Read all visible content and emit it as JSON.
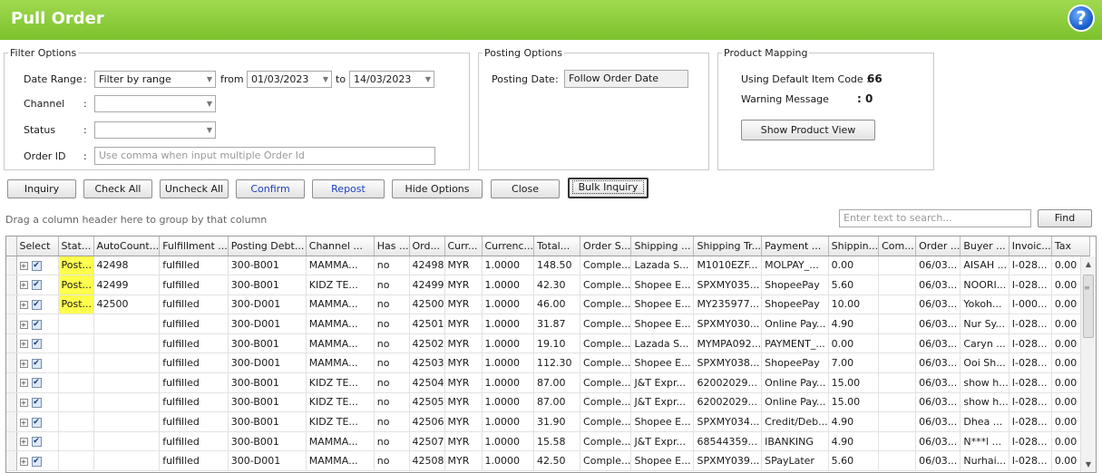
{
  "window": {
    "title": "Pull Order",
    "help_icon": "help-icon"
  },
  "filter_options": {
    "legend": "Filter Options",
    "date_range": {
      "label": "Date Range",
      "value": "Filter by range",
      "from_label": "from",
      "from_value": "01/03/2023",
      "to_label": "to",
      "to_value": "14/03/2023"
    },
    "channel": {
      "label": "Channel",
      "value": ""
    },
    "status": {
      "label": "Status",
      "value": ""
    },
    "order_id": {
      "label": "Order ID",
      "placeholder": "Use comma when input multiple Order Id"
    }
  },
  "posting_options": {
    "legend": "Posting Options",
    "posting_date_label": "Posting Date",
    "posting_date_value": "Follow Order Date"
  },
  "product_mapping": {
    "legend": "Product Mapping",
    "default_item_label": "Using Default Item Code :",
    "default_item_value": "66",
    "warning_label": "Warning Message",
    "warning_value": ": 0",
    "show_product_view": "Show Product View"
  },
  "toolbar": {
    "inquiry": "Inquiry",
    "check_all": "Check All",
    "uncheck_all": "Uncheck All",
    "confirm": "Confirm",
    "repost": "Repost",
    "hide_options": "Hide Options",
    "close": "Close",
    "bulk_inquiry": "Bulk Inquiry"
  },
  "grid_hint": "Drag a column header here to group by that column",
  "search": {
    "placeholder": "Enter text to search...",
    "find": "Find"
  },
  "colors": {
    "title_bar": "#7cc22e",
    "posted_highlight": "#ffff4d",
    "link_blue": "#1d3fbf"
  },
  "columns": [
    "Select",
    "Stat...",
    "AutoCount...",
    "Fulfillment ...",
    "Posting Debt...",
    "Channel ...",
    "Has ...",
    "Ord...",
    "Curr...",
    "Currenc...",
    "Total...",
    "Order S...",
    "Shipping ...",
    "Shipping Tr...",
    "Payment ...",
    "Shippin...",
    "Com...",
    "Order ...",
    "Buyer ...",
    "Invoic...",
    "Tax"
  ],
  "rows": [
    [
      "Post...",
      "42498",
      "fulfilled",
      "300-B001",
      "MAMMA...",
      "no",
      "42498",
      "MYR",
      "1.0000",
      "148.50",
      "Comple...",
      "Lazada S...",
      "M1010EZF...",
      "MOLPAY_...",
      "0.00",
      "",
      "06/03...",
      "AISAH ...",
      "I-028...",
      "0.00"
    ],
    [
      "Post...",
      "42499",
      "fulfilled",
      "300-B001",
      "KIDZ TE...",
      "no",
      "42499",
      "MYR",
      "1.0000",
      "42.30",
      "Comple...",
      "Shopee E...",
      "SPXMY035...",
      "ShopeePay",
      "5.60",
      "",
      "06/03...",
      "NOORI...",
      "I-028...",
      "0.00"
    ],
    [
      "Post...",
      "42500",
      "fulfilled",
      "300-D001",
      "MAMMA...",
      "no",
      "42500",
      "MYR",
      "1.0000",
      "46.00",
      "Comple...",
      "Shopee E...",
      "MY235977...",
      "ShopeePay",
      "10.00",
      "",
      "06/03...",
      "Yokoh...",
      "I-000...",
      "0.00"
    ],
    [
      "",
      "",
      "fulfilled",
      "300-D001",
      "MAMMA...",
      "no",
      "42501",
      "MYR",
      "1.0000",
      "31.87",
      "Comple...",
      "Shopee E...",
      "SPXMY030...",
      "Online Pay...",
      "4.90",
      "",
      "06/03...",
      "Nur Sy...",
      "I-028...",
      "0.00"
    ],
    [
      "",
      "",
      "fulfilled",
      "300-B001",
      "MAMMA...",
      "no",
      "42502",
      "MYR",
      "1.0000",
      "19.10",
      "Comple...",
      "Lazada S...",
      "MYMPA092...",
      "PAYMENT_...",
      "0.00",
      "",
      "06/03...",
      "Caryn ...",
      "I-028...",
      "0.00"
    ],
    [
      "",
      "",
      "fulfilled",
      "300-D001",
      "MAMMA...",
      "no",
      "42503",
      "MYR",
      "1.0000",
      "112.30",
      "Comple...",
      "Shopee E...",
      "SPXMY038...",
      "ShopeePay",
      "7.00",
      "",
      "06/03...",
      "Ooi Sh...",
      "I-028...",
      "0.00"
    ],
    [
      "",
      "",
      "fulfilled",
      "300-B001",
      "KIDZ TE...",
      "no",
      "42504",
      "MYR",
      "1.0000",
      "87.00",
      "Comple...",
      "J&T Expr...",
      "62002029...",
      "Online Pay...",
      "15.00",
      "",
      "06/03...",
      "show h...",
      "I-028...",
      "0.00"
    ],
    [
      "",
      "",
      "fulfilled",
      "300-B001",
      "KIDZ TE...",
      "no",
      "42505",
      "MYR",
      "1.0000",
      "87.00",
      "Comple...",
      "J&T Expr...",
      "62002029...",
      "Online Pay...",
      "15.00",
      "",
      "06/03...",
      "show h...",
      "I-028...",
      "0.00"
    ],
    [
      "",
      "",
      "fulfilled",
      "300-B001",
      "KIDZ TE...",
      "no",
      "42506",
      "MYR",
      "1.0000",
      "31.90",
      "Comple...",
      "Shopee E...",
      "SPXMY034...",
      "Credit/Deb...",
      "4.90",
      "",
      "06/03...",
      "Dhea ...",
      "I-028...",
      "0.00"
    ],
    [
      "",
      "",
      "fulfilled",
      "300-B001",
      "MAMMA...",
      "no",
      "42507",
      "MYR",
      "1.0000",
      "15.58",
      "Comple...",
      "J&T Expr...",
      "68544359...",
      "IBANKING",
      "4.90",
      "",
      "06/03...",
      "N***l ...",
      "I-028...",
      "0.00"
    ],
    [
      "",
      "",
      "fulfilled",
      "300-D001",
      "MAMMA...",
      "no",
      "42508",
      "MYR",
      "1.0000",
      "42.50",
      "Comple...",
      "Shopee E...",
      "SPXMY039...",
      "SPayLater",
      "5.60",
      "",
      "06/03...",
      "Nurhai...",
      "I-028...",
      "0.00"
    ]
  ]
}
